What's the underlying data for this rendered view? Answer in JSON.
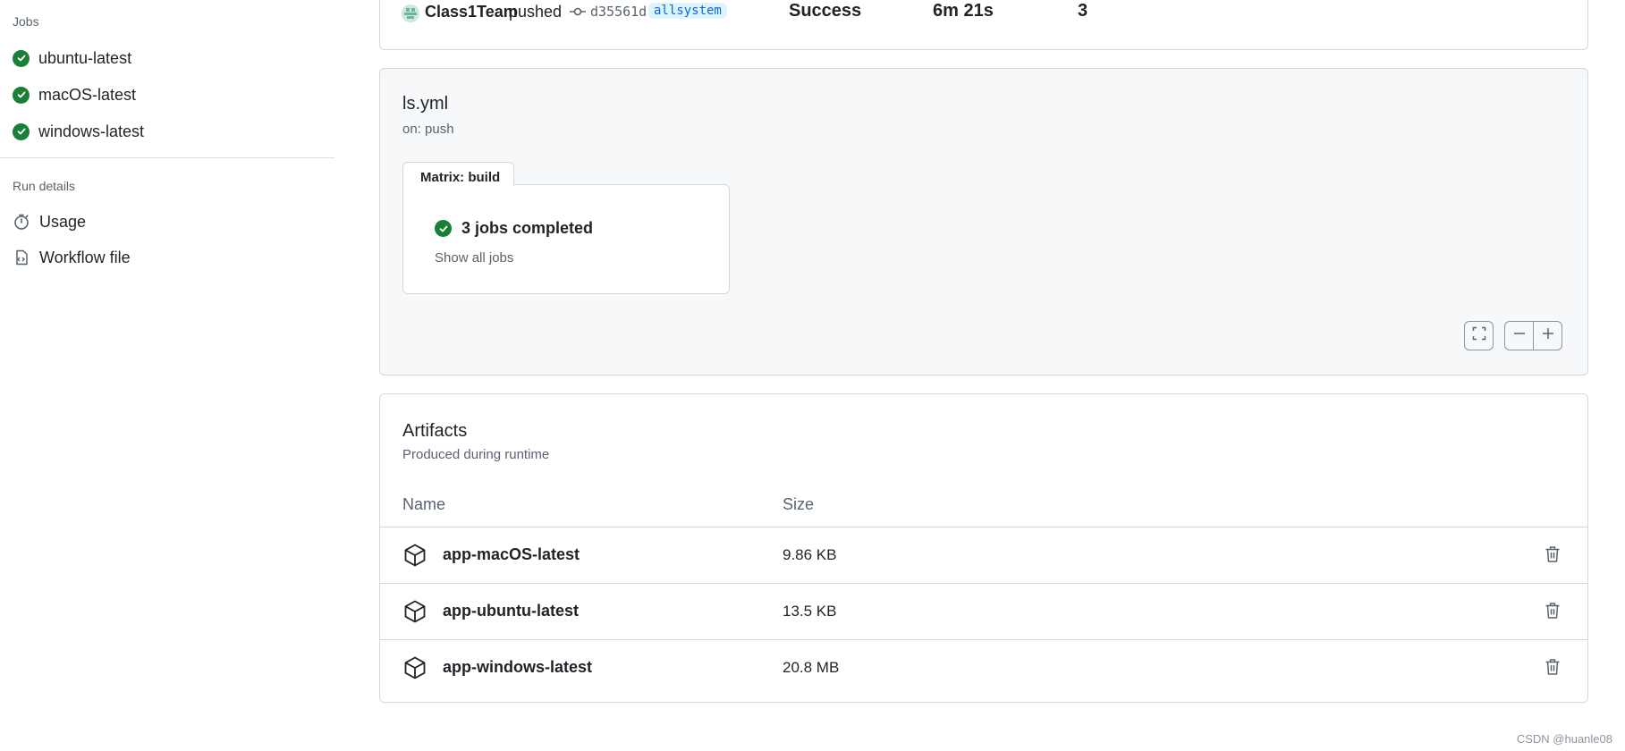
{
  "sidebar": {
    "jobs_heading": "Jobs",
    "jobs": [
      {
        "label": "ubuntu-latest",
        "status": "success"
      },
      {
        "label": "macOS-latest",
        "status": "success"
      },
      {
        "label": "windows-latest",
        "status": "success"
      }
    ],
    "run_details_heading": "Run details",
    "run_details": [
      {
        "label": "Usage",
        "icon": "stopwatch-icon"
      },
      {
        "label": "Workflow file",
        "icon": "file-code-icon"
      }
    ]
  },
  "summary": {
    "actor": "Class1Team",
    "action": "pushed",
    "commit_sha": "d35561d",
    "branch": "allsystem",
    "status": "Success",
    "duration": "6m 21s",
    "artifact_count": "3"
  },
  "workflow": {
    "file_name": "ls.yml",
    "trigger": "on: push",
    "matrix_tab": "Matrix: build",
    "matrix_status": "3 jobs completed",
    "show_all_jobs": "Show all jobs"
  },
  "artifacts": {
    "title": "Artifacts",
    "subtitle": "Produced during runtime",
    "columns": {
      "name": "Name",
      "size": "Size"
    },
    "rows": [
      {
        "name": "app-macOS-latest",
        "size": "9.86 KB"
      },
      {
        "name": "app-ubuntu-latest",
        "size": "13.5 KB"
      },
      {
        "name": "app-windows-latest",
        "size": "20.8 MB"
      }
    ]
  },
  "watermark": "CSDN @huanle08",
  "colors": {
    "success_green": "#1a7f37",
    "branch_bg": "#ddf4ff",
    "branch_fg": "#0969da",
    "border": "#d1d9e0"
  }
}
